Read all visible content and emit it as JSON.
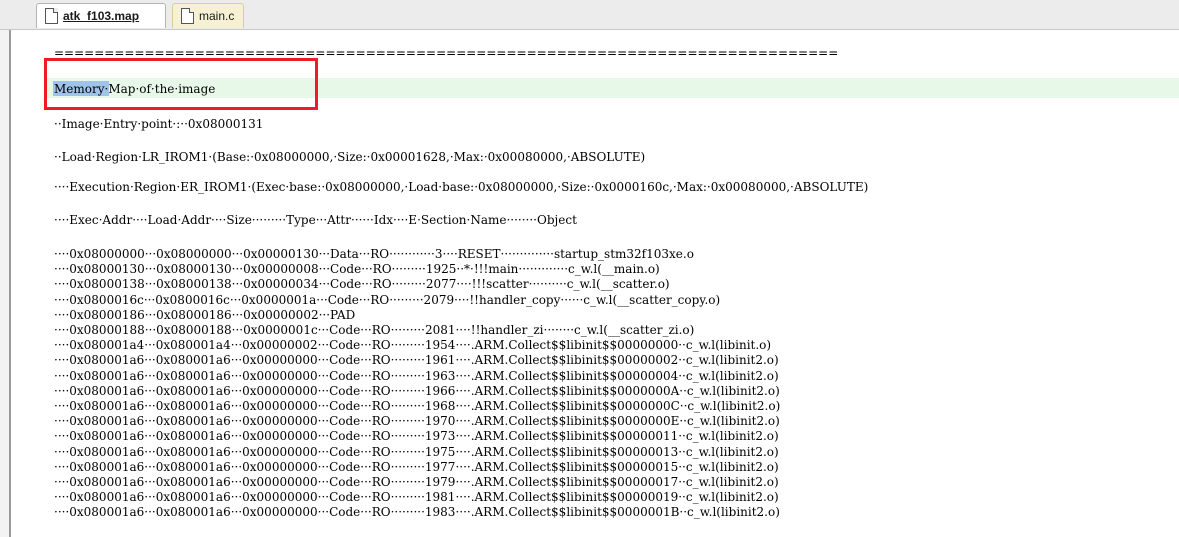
{
  "tabs": [
    {
      "label": "atk_f103.map",
      "active": true
    },
    {
      "label": "main.c",
      "active": false
    }
  ],
  "editor": {
    "separator": "==============================================================================",
    "heading_word": "Memory",
    "heading_rest": "·Map·of·the·image",
    "entry_point": "··Image·Entry·point·:··0x08000131",
    "load_region": "··Load·Region·LR_IROM1·(Base:·0x08000000,·Size:·0x00001628,·Max:·0x00080000,·ABSOLUTE)",
    "exec_region": "····Execution·Region·ER_IROM1·(Exec·base:·0x08000000,·Load·base:·0x08000000,·Size:·0x0000160c,·Max:·0x00080000,·ABSOLUTE)",
    "column_header": "····Exec·Addr····Load·Addr····Size·········Type···Attr······Idx····E·Section·Name········Object",
    "rows": [
      "····0x08000000···0x08000000···0x00000130···Data···RO············3····RESET··············startup_stm32f103xe.o",
      "····0x08000130···0x08000130···0x00000008···Code···RO·········1925··*·!!!main·············c_w.l(__main.o)",
      "····0x08000138···0x08000138···0x00000034···Code···RO·········2077····!!!scatter··········c_w.l(__scatter.o)",
      "····0x0800016c···0x0800016c···0x0000001a···Code···RO·········2079····!!handler_copy······c_w.l(__scatter_copy.o)",
      "····0x08000186···0x08000186···0x00000002···PAD",
      "····0x08000188···0x08000188···0x0000001c···Code···RO·········2081····!!handler_zi········c_w.l(__scatter_zi.o)",
      "····0x080001a4···0x080001a4···0x00000002···Code···RO·········1954····.ARM.Collect$$libinit$$00000000··c_w.l(libinit.o)",
      "····0x080001a6···0x080001a6···0x00000000···Code···RO·········1961····.ARM.Collect$$libinit$$00000002··c_w.l(libinit2.o)",
      "····0x080001a6···0x080001a6···0x00000000···Code···RO·········1963····.ARM.Collect$$libinit$$00000004··c_w.l(libinit2.o)",
      "····0x080001a6···0x080001a6···0x00000000···Code···RO·········1966····.ARM.Collect$$libinit$$0000000A··c_w.l(libinit2.o)",
      "····0x080001a6···0x080001a6···0x00000000···Code···RO·········1968····.ARM.Collect$$libinit$$0000000C··c_w.l(libinit2.o)",
      "····0x080001a6···0x080001a6···0x00000000···Code···RO·········1970····.ARM.Collect$$libinit$$0000000E··c_w.l(libinit2.o)",
      "····0x080001a6···0x080001a6···0x00000000···Code···RO·········1973····.ARM.Collect$$libinit$$00000011··c_w.l(libinit2.o)",
      "····0x080001a6···0x080001a6···0x00000000···Code···RO·········1975····.ARM.Collect$$libinit$$00000013··c_w.l(libinit2.o)",
      "····0x080001a6···0x080001a6···0x00000000···Code···RO·········1977····.ARM.Collect$$libinit$$00000015··c_w.l(libinit2.o)",
      "····0x080001a6···0x080001a6···0x00000000···Code···RO·········1979····.ARM.Collect$$libinit$$00000017··c_w.l(libinit2.o)",
      "····0x080001a6···0x080001a6···0x00000000···Code···RO·········1981····.ARM.Collect$$libinit$$00000019··c_w.l(libinit2.o)",
      "····0x080001a6···0x080001a6···0x00000000···Code···RO·········1983····.ARM.Collect$$libinit$$0000001B··c_w.l(libinit2.o)"
    ]
  },
  "colors": {
    "highlight_line": "#e8f8e8",
    "selection": "#9fc3ea",
    "callout_border": "#ee1c25"
  }
}
